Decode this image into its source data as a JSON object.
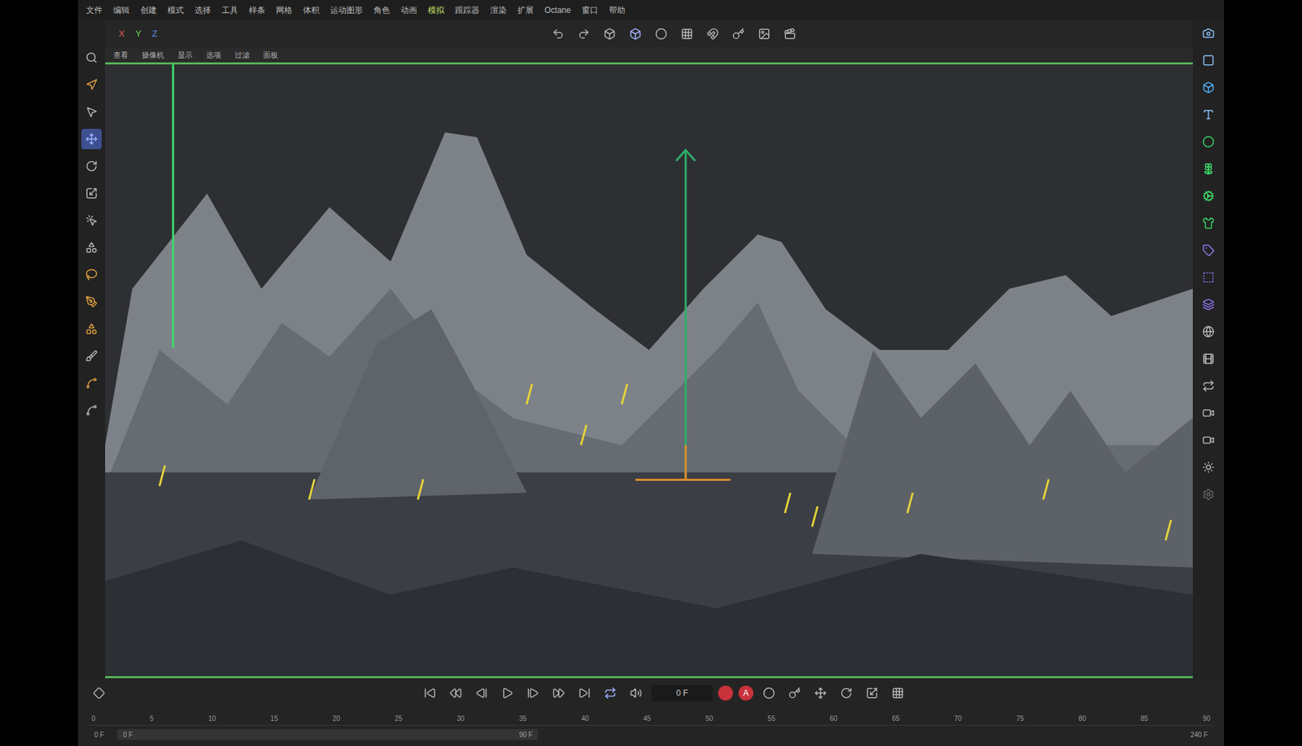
{
  "menu": [
    {
      "label": "文件",
      "highlighted": false
    },
    {
      "label": "编辑",
      "highlighted": false
    },
    {
      "label": "创建",
      "highlighted": false
    },
    {
      "label": "模式",
      "highlighted": false
    },
    {
      "label": "选择",
      "highlighted": false
    },
    {
      "label": "工具",
      "highlighted": false
    },
    {
      "label": "样条",
      "highlighted": false
    },
    {
      "label": "网格",
      "highlighted": false
    },
    {
      "label": "体积",
      "highlighted": false
    },
    {
      "label": "运动图形",
      "highlighted": false
    },
    {
      "label": "角色",
      "highlighted": false
    },
    {
      "label": "动画",
      "highlighted": false
    },
    {
      "label": "模拟",
      "highlighted": true
    },
    {
      "label": "跟踪器",
      "highlighted": false
    },
    {
      "label": "渲染",
      "highlighted": false
    },
    {
      "label": "扩展",
      "highlighted": false
    },
    {
      "label": "Octane",
      "highlighted": false
    },
    {
      "label": "窗口",
      "highlighted": false
    },
    {
      "label": "帮助",
      "highlighted": false
    }
  ],
  "axes": [
    {
      "label": "X",
      "color": "#e05555"
    },
    {
      "label": "Y",
      "color": "#6fcf4f"
    },
    {
      "label": "Z",
      "color": "#5b8def"
    }
  ],
  "viewport_menu": [
    "查看",
    "摄像机",
    "显示",
    "选项",
    "过滤",
    "面板"
  ],
  "timeline": {
    "current_frame": "0 F",
    "autokey_label": "A",
    "ticks": [
      "0",
      "5",
      "10",
      "15",
      "20",
      "25",
      "30",
      "35",
      "40",
      "45",
      "50",
      "55",
      "60",
      "65",
      "70",
      "75",
      "80",
      "85",
      "90"
    ],
    "range_start": "0 F",
    "range_from": "0 F",
    "range_to": "90 F",
    "range_end": "240 F"
  }
}
